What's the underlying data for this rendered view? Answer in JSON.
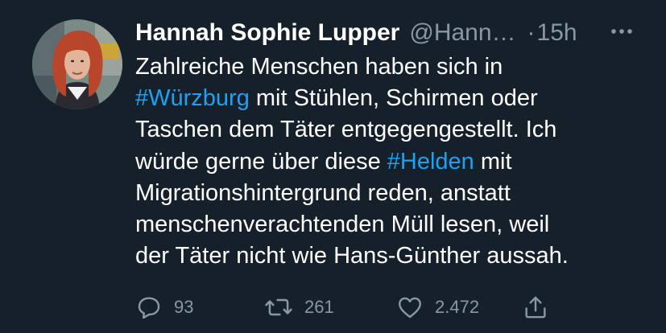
{
  "tweet": {
    "author_name": "Hannah Sophie Lupper",
    "handle": "@Hann…",
    "separator": "·",
    "time": "15h",
    "text_segments": {
      "l1": "Zahlreiche Menschen haben sich in",
      "l2_tag": "#Würzburg",
      "l2_rest": " mit Stühlen, Schirmen oder",
      "l3": "Taschen dem Täter entgegengestellt. Ich",
      "l4_pre": "würde gerne über diese ",
      "l4_tag": "#Helden",
      "l4_post": " mit",
      "l5": "Migrationshintergrund reden, anstatt",
      "l6": "menschenverachtenden Müll lesen, weil",
      "l7": "der Täter nicht wie Hans-Günther aussah."
    },
    "actions": {
      "replies": "93",
      "retweets": "261",
      "likes": "2.472"
    }
  },
  "icons": {
    "more": "more-icon",
    "reply": "reply-icon",
    "retweet": "retweet-icon",
    "like": "heart-icon",
    "share": "share-icon"
  },
  "colors": {
    "background": "#15202b",
    "text": "#ffffff",
    "secondary": "#8899a6",
    "hashtag": "#1da1f2"
  }
}
